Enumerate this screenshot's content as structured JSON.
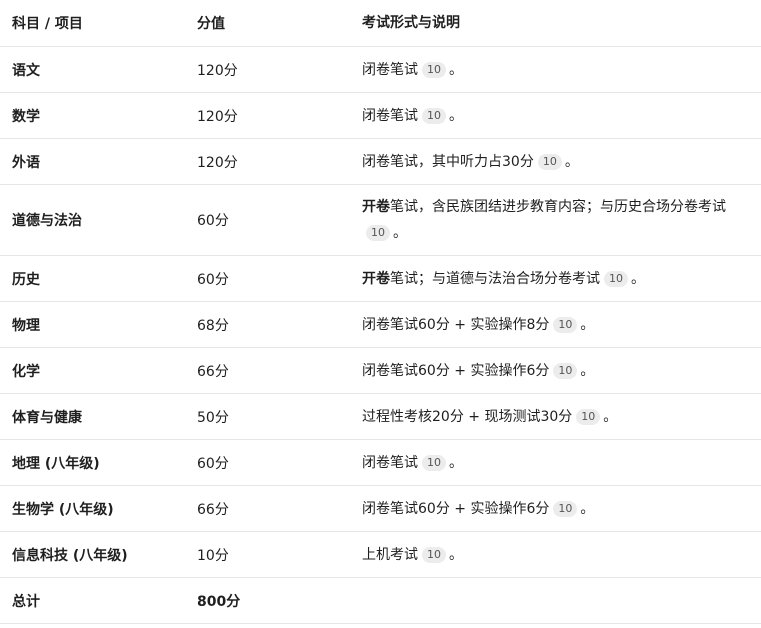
{
  "header": {
    "col1": "科目 / 项目",
    "col2": "分值",
    "col3": "考试形式与说明"
  },
  "rows": [
    {
      "subject": "语文",
      "score": "120分",
      "desc_pre": "",
      "desc_bold": "",
      "desc": "闭卷笔试",
      "cite": "10",
      "end": "。"
    },
    {
      "subject": "数学",
      "score": "120分",
      "desc_pre": "",
      "desc_bold": "",
      "desc": "闭卷笔试",
      "cite": "10",
      "end": "。"
    },
    {
      "subject": "外语",
      "score": "120分",
      "desc_pre": "",
      "desc_bold": "",
      "desc": "闭卷笔试，其中听力占30分",
      "cite": "10",
      "end": "。"
    },
    {
      "subject": "道德与法治",
      "score": "60分",
      "desc_bold": "开卷",
      "desc": "笔试，含民族团结进步教育内容；与历史合场分卷考试",
      "cite": "10",
      "end": "。"
    },
    {
      "subject": "历史",
      "score": "60分",
      "desc_bold": "开卷",
      "desc": "笔试；与道德与法治合场分卷考试",
      "cite": "10",
      "end": "。"
    },
    {
      "subject": "物理",
      "score": "68分",
      "desc_bold": "",
      "desc": "闭卷笔试60分 + 实验操作8分",
      "cite": "10",
      "end": "。"
    },
    {
      "subject": "化学",
      "score": "66分",
      "desc_bold": "",
      "desc": "闭卷笔试60分 + 实验操作6分",
      "cite": "10",
      "end": "。"
    },
    {
      "subject": "体育与健康",
      "score": "50分",
      "desc_bold": "",
      "desc": "过程性考核20分 + 现场测试30分",
      "cite": "10",
      "end": "。"
    },
    {
      "subject": "地理 (八年级)",
      "score": "60分",
      "desc_bold": "",
      "desc": "闭卷笔试",
      "cite": "10",
      "end": "。"
    },
    {
      "subject": "生物学 (八年级)",
      "score": "66分",
      "desc_bold": "",
      "desc": "闭卷笔试60分 + 实验操作6分",
      "cite": "10",
      "end": "。"
    },
    {
      "subject": "信息科技 (八年级)",
      "score": "10分",
      "desc_bold": "",
      "desc": "上机考试",
      "cite": "10",
      "end": "。"
    }
  ],
  "total": {
    "label": "总计",
    "score": "800分"
  }
}
